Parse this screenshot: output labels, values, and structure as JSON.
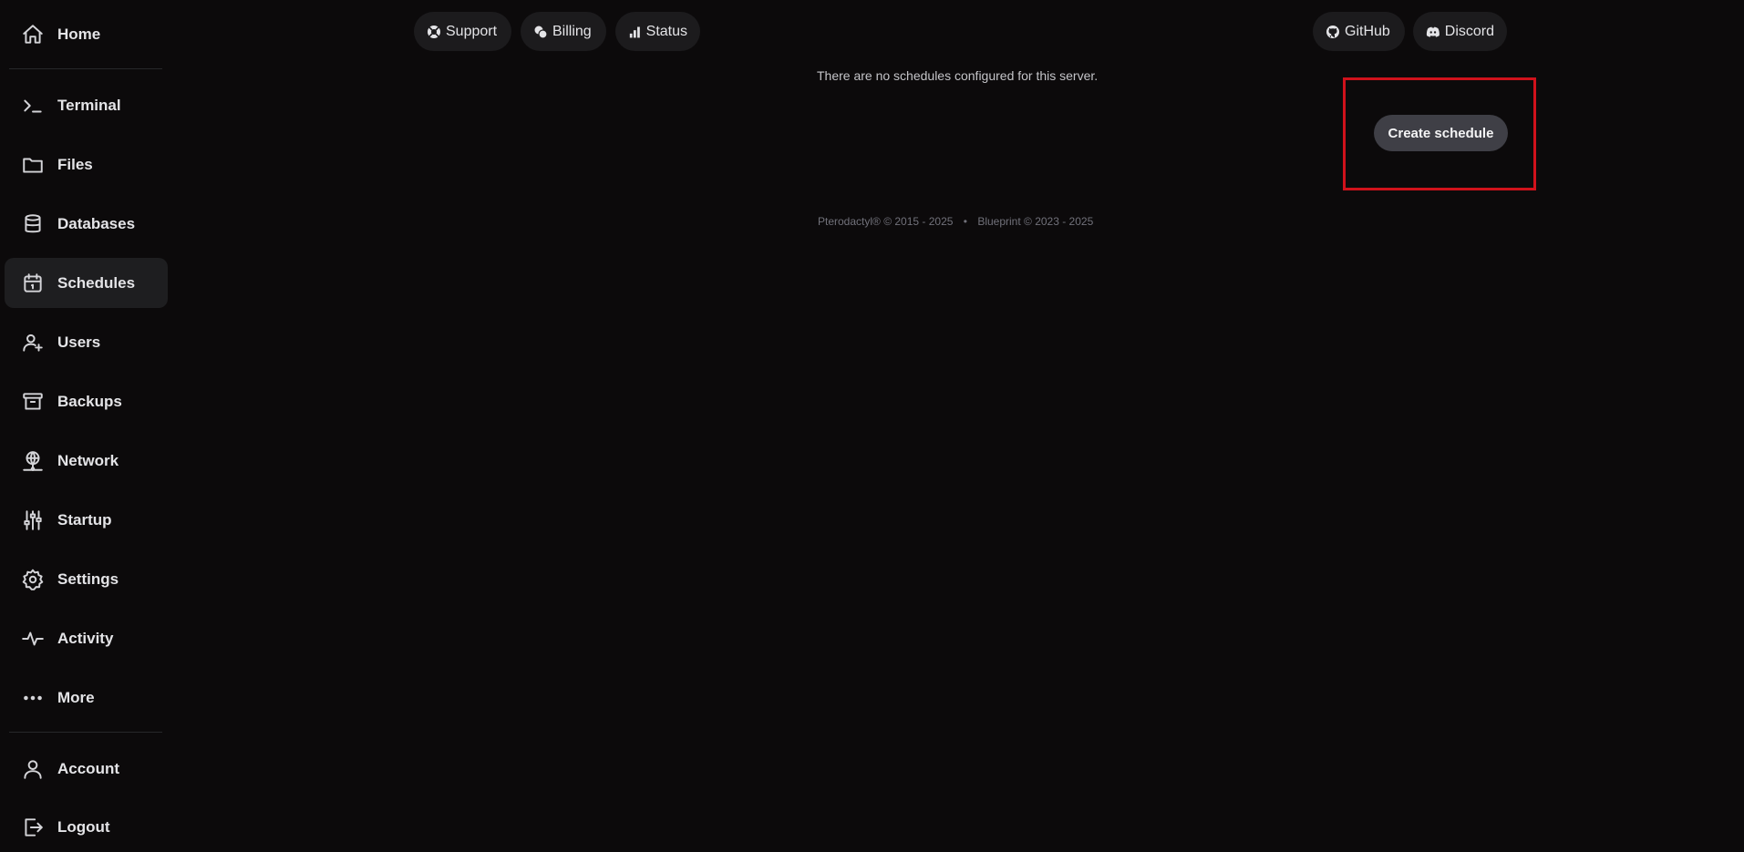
{
  "sidebar": {
    "items": [
      {
        "label": "Home",
        "icon": "home-icon"
      },
      {
        "label": "Terminal",
        "icon": "terminal-icon"
      },
      {
        "label": "Files",
        "icon": "folder-icon"
      },
      {
        "label": "Databases",
        "icon": "database-icon"
      },
      {
        "label": "Schedules",
        "icon": "calendar-icon",
        "active": true
      },
      {
        "label": "Users",
        "icon": "users-plus-icon"
      },
      {
        "label": "Backups",
        "icon": "archive-icon"
      },
      {
        "label": "Network",
        "icon": "globe-network-icon"
      },
      {
        "label": "Startup",
        "icon": "sliders-icon"
      },
      {
        "label": "Settings",
        "icon": "gear-icon"
      },
      {
        "label": "Activity",
        "icon": "pulse-icon"
      },
      {
        "label": "More",
        "icon": "ellipsis-icon"
      },
      {
        "label": "Account",
        "icon": "user-icon"
      },
      {
        "label": "Logout",
        "icon": "logout-icon"
      }
    ]
  },
  "topbar": {
    "support": "Support",
    "billing": "Billing",
    "status": "Status",
    "github": "GitHub",
    "discord": "Discord"
  },
  "main": {
    "empty_message": "There are no schedules configured for this server.",
    "create_button": "Create schedule"
  },
  "footer": {
    "pterodactyl": "Pterodactyl® © 2015 - 2025",
    "separator": "•",
    "blueprint": "Blueprint © 2023 - 2025"
  },
  "colors": {
    "background": "#0c0a0b",
    "active_item": "#1e1e20",
    "pill": "#1c1b1d",
    "button": "#3f3f46",
    "highlight": "#d0121b"
  }
}
